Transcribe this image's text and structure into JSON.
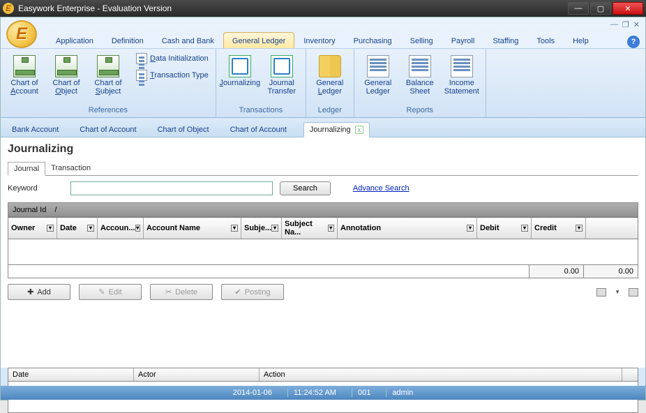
{
  "window": {
    "title": "Easywork Enterprise - Evaluation Version"
  },
  "menu": {
    "items": [
      "Application",
      "Definition",
      "Cash and Bank",
      "General Ledger",
      "Inventory",
      "Purchasing",
      "Selling",
      "Payroll",
      "Staffing",
      "Tools",
      "Help"
    ],
    "active": "General Ledger"
  },
  "ribbon": {
    "groups": [
      {
        "label": "References",
        "big": [
          {
            "name": "chart-of-account",
            "label": "Chart of Account",
            "u": "A"
          },
          {
            "name": "chart-of-object",
            "label": "Chart of Object",
            "u": "O"
          },
          {
            "name": "chart-of-subject",
            "label": "Chart of Subject",
            "u": "S"
          }
        ],
        "small": [
          {
            "name": "data-initialization",
            "label": "Data Initialization",
            "u": "D"
          },
          {
            "name": "transaction-type",
            "label": "Transaction Type",
            "u": "T"
          }
        ]
      },
      {
        "label": "Transactions",
        "big": [
          {
            "name": "journalizing",
            "label": "Journalizing",
            "u": "J"
          },
          {
            "name": "journal-transfer",
            "label": "Journal Transfer",
            "u": ""
          }
        ]
      },
      {
        "label": "Ledger",
        "big": [
          {
            "name": "general-ledger",
            "label": "General Ledger",
            "u": "L"
          }
        ]
      },
      {
        "label": "Reports",
        "big": [
          {
            "name": "report-general-ledger",
            "label": "General Ledger",
            "u": ""
          },
          {
            "name": "balance-sheet",
            "label": "Balance Sheet",
            "u": ""
          },
          {
            "name": "income-statement",
            "label": "Income Statement",
            "u": ""
          }
        ]
      }
    ]
  },
  "doctabs": {
    "items": [
      "Bank Account",
      "Chart of Account",
      "Chart of Object",
      "Chart of Account",
      "Journalizing"
    ],
    "active": "Journalizing"
  },
  "page": {
    "title": "Journalizing",
    "subtabs": [
      "Journal",
      "Transaction"
    ],
    "active_subtab": "Journal",
    "keyword_label": "Keyword",
    "search_label": "Search",
    "advance_label": "Advance Search",
    "group_header": "Journal Id",
    "columns": [
      "Owner",
      "Date",
      "Accoun...",
      "Account Name",
      "Subje...",
      "Subject Na...",
      "Annotation",
      "Debit",
      "Credit"
    ],
    "totals": {
      "debit": "0.00",
      "credit": "0.00"
    },
    "actions": {
      "add": "Add",
      "edit": "Edit",
      "delete": "Delete",
      "posting": "Posting"
    },
    "log_columns": [
      "Date",
      "Actor",
      "Action"
    ]
  },
  "status": {
    "date": "2014-01-06",
    "time": "11:24:52 AM",
    "code": "001",
    "user": "admin"
  }
}
